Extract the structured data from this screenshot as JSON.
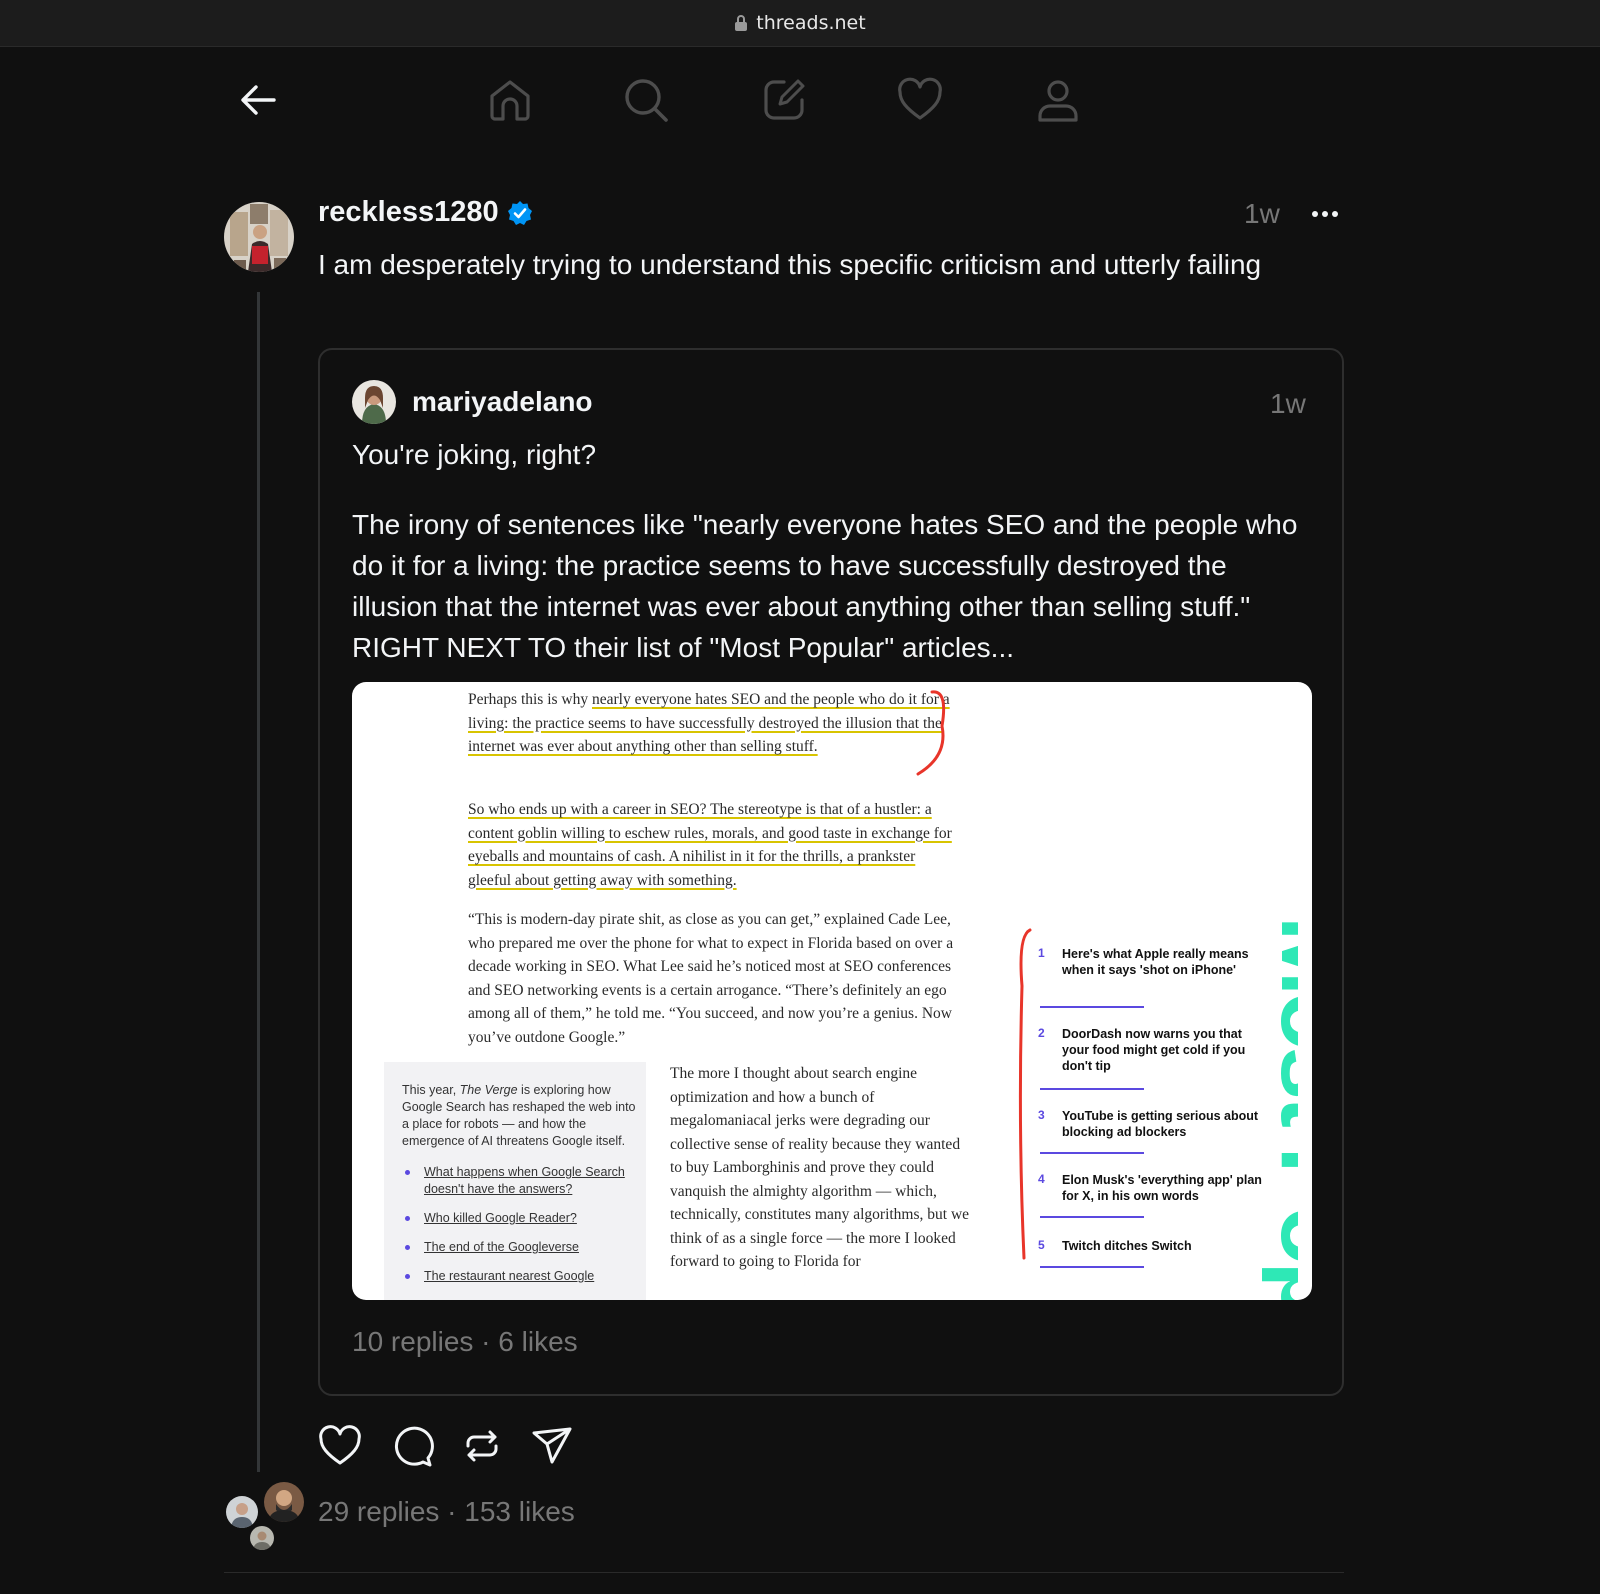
{
  "browser": {
    "url": "threads.net"
  },
  "nav": {
    "icons": [
      "back-arrow-icon",
      "home-icon",
      "search-icon",
      "compose-icon",
      "heart-icon",
      "profile-icon"
    ]
  },
  "post": {
    "username": "reckless1280",
    "time": "1w",
    "text": "I am desperately trying to understand this specific criticism and utterly failing",
    "stats": "29 replies · 153 likes"
  },
  "quote": {
    "username": "mariyadelano",
    "time": "1w",
    "text_1": "You're joking, right?",
    "text_2": "The irony of sentences like \"nearly everyone hates SEO and the people who do it for a living: the practice seems to have successfully destroyed the illusion that the internet was ever about anything other than selling stuff.\" RIGHT NEXT TO their list of \"Most Popular\" articles...",
    "stats": "10 replies · 6 likes"
  },
  "screenshot": {
    "p1_plain": "Perhaps this is why ",
    "p1_highlight": "nearly everyone hates SEO and the people who do it for a living: the practice seems to have successfully destroyed the illusion that the internet was ever about anything other than selling stuff.",
    "p2": "So who ends up with a career in SEO? The stereotype is that of a hustler: a content goblin willing to eschew rules, morals, and good taste in exchange for eyeballs and mountains of cash. A nihilist in it for the thrills, a prankster gleeful about getting away with something.",
    "p3": "“This is modern-day pirate shit, as close as you can get,” explained Cade Lee, who prepared me over the phone for what to expect in Florida based on over a decade working in SEO. What Lee said he’s noticed most at SEO conferences and SEO networking events is a certain arrogance. “There’s definitely an ego among all of them,” he told me. “You succeed, and now you’re a genius. Now you’ve outdone Google.”",
    "sidebox_intro_1": "This year, ",
    "sidebox_intro_em": "The Verge",
    "sidebox_intro_2": " is exploring how Google Search has reshaped the web into a place for robots — and how the emergence of AI threatens Google itself.",
    "sidebox_links": [
      "What happens when Google Search doesn't have the answers?",
      "Who killed Google Reader?",
      "The end of the Googleverse",
      "The restaurant nearest Google"
    ],
    "col2": "The more I thought about search engine optimization and how a bunch of megalomaniacal jerks were degrading our collective sense of reality because they wanted to buy Lamborghinis and prove they could vanquish the almighty algorithm — which, technically, constitutes many algorithms, but we think of as a single force — the more I looked forward to going to Florida for",
    "most_popular_label": "Most Popular",
    "popular": [
      {
        "num": "1",
        "title": "Here's what Apple really means when it says 'shot on iPhone'"
      },
      {
        "num": "2",
        "title": "DoorDash now warns you that your food might get cold if you don't tip"
      },
      {
        "num": "3",
        "title": "YouTube is getting serious about blocking ad blockers"
      },
      {
        "num": "4",
        "title": "Elon Musk's 'everything app' plan for X, in his own words"
      },
      {
        "num": "5",
        "title": "Twitch ditches Switch"
      }
    ]
  },
  "colors": {
    "background": "#101010",
    "text": "#f3f5f7",
    "muted": "#777777",
    "border": "#2e2e2e",
    "verified": "#0095f6",
    "annotation_red": "#e8352a",
    "popular_green": "#2ee8b6",
    "popular_purple": "#5b49e0"
  },
  "actions": [
    "like-icon",
    "comment-icon",
    "repost-icon",
    "share-icon"
  ]
}
